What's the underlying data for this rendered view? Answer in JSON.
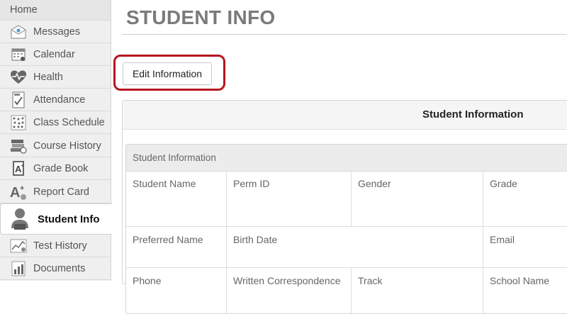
{
  "sidebar": {
    "items": [
      {
        "label": "Home",
        "icon": "home"
      },
      {
        "label": "Messages",
        "icon": "messages-icon"
      },
      {
        "label": "Calendar",
        "icon": "calendar-icon"
      },
      {
        "label": "Health",
        "icon": "health-icon"
      },
      {
        "label": "Attendance",
        "icon": "attendance-icon"
      },
      {
        "label": "Class Schedule",
        "icon": "class-schedule-icon"
      },
      {
        "label": "Course History",
        "icon": "course-history-icon"
      },
      {
        "label": "Grade Book",
        "icon": "grade-book-icon"
      },
      {
        "label": "Report Card",
        "icon": "report-card-icon"
      },
      {
        "label": "Student Info",
        "icon": "student-info-icon",
        "active": true
      },
      {
        "label": "Test History",
        "icon": "test-history-icon"
      },
      {
        "label": "Documents",
        "icon": "documents-icon"
      }
    ]
  },
  "main": {
    "title": "STUDENT INFO",
    "edit_button_label": "Edit Information",
    "panel_title": "Student Information",
    "section_title": "Student Information",
    "rows": [
      [
        "Student Name",
        "Perm ID",
        "Gender",
        "Grade"
      ],
      [
        "Preferred Name",
        "Birth Date",
        "",
        "Email"
      ],
      [
        "Phone",
        "Written Correspondence",
        "Track",
        "School Name"
      ]
    ]
  },
  "colors": {
    "highlight": "#b5161e",
    "title": "#7a7a7a",
    "sidebar_bg": "#ececec"
  }
}
